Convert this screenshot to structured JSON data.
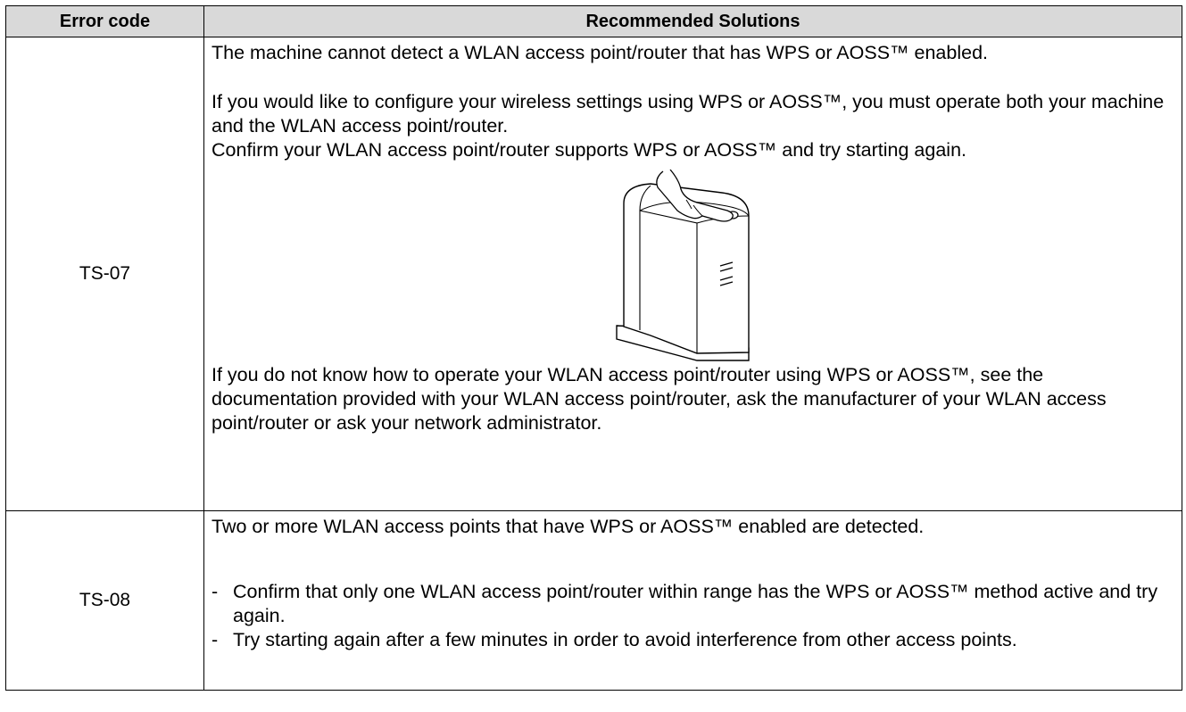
{
  "table": {
    "headers": {
      "code": "Error code",
      "solutions": "Recommended Solutions"
    },
    "rows": [
      {
        "code": "TS-07",
        "p1": "The machine cannot detect a WLAN access point/router that has WPS or AOSS™ enabled.",
        "p2": "If you would like to configure your wireless settings using WPS or AOSS™, you must operate both your machine and the WLAN access point/router.",
        "p3": "Confirm your WLAN access point/router supports WPS or AOSS™ and try starting again.",
        "p4": "If you do not know how to operate your WLAN access point/router using WPS or AOSS™, see the documentation provided with your WLAN access point/router, ask the manufacturer of your WLAN access point/router or ask your network administrator."
      },
      {
        "code": "TS-08",
        "p1": "Two or more WLAN access points that have WPS or AOSS™ enabled are detected.",
        "bullets": [
          "Confirm that only one WLAN access point/router within range has the WPS or AOSS™ method active and try again.",
          "Try starting again after a few minutes in order to avoid interference from other access points."
        ],
        "dash": "-"
      }
    ]
  }
}
